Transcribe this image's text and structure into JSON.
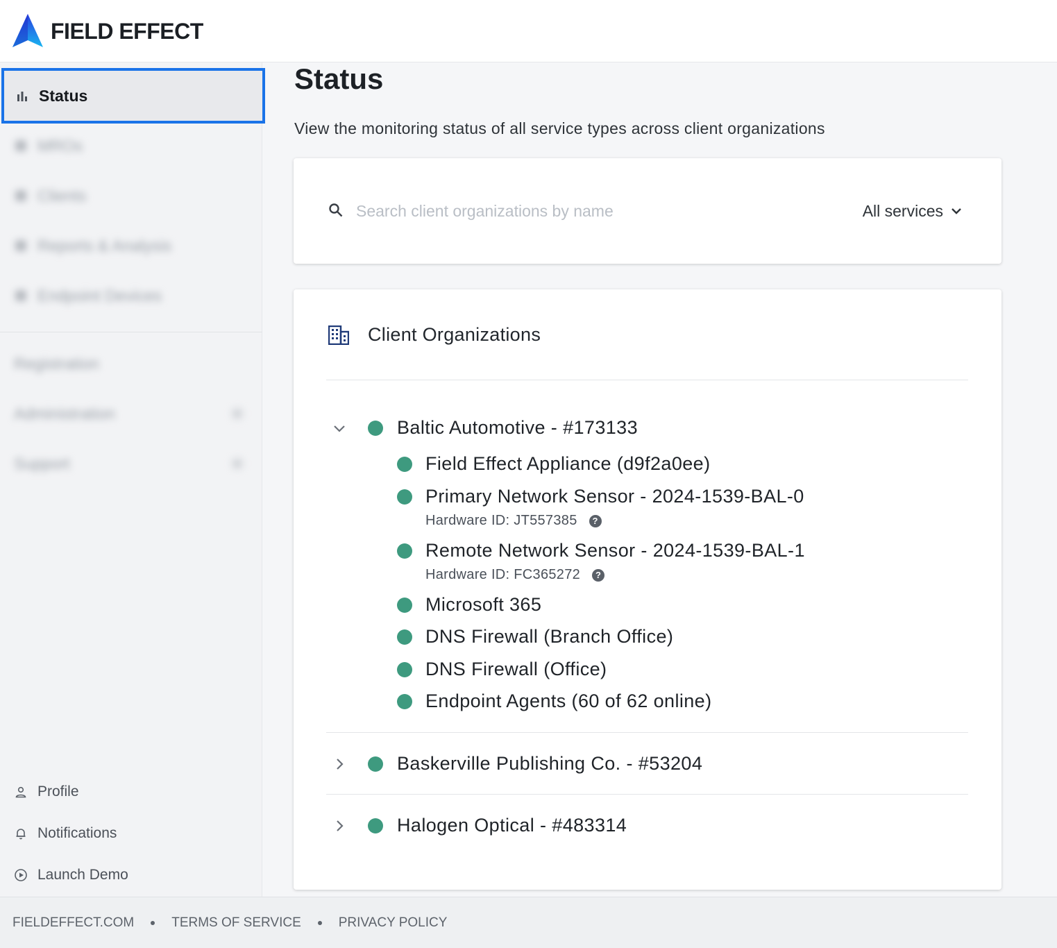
{
  "brand": {
    "name": "FIELD EFFECT"
  },
  "sidebar": {
    "items": [
      {
        "label": "Status",
        "icon": "bar-chart-icon",
        "active": true
      },
      {
        "label": "MROs",
        "icon": "building-icon",
        "blurred": true
      },
      {
        "label": "Clients",
        "icon": "users-icon",
        "blurred": true
      },
      {
        "label": "Reports & Analysis",
        "icon": "report-icon",
        "blurred": true
      },
      {
        "label": "Endpoint Devices",
        "icon": "laptop-icon",
        "blurred": true
      }
    ],
    "secondary": [
      {
        "label": "Registration",
        "blurred": true
      },
      {
        "label": "Administration",
        "blurred": true
      },
      {
        "label": "Support",
        "blurred": true
      }
    ],
    "bottom": [
      {
        "label": "Profile",
        "icon": "person-icon"
      },
      {
        "label": "Notifications",
        "icon": "bell-icon"
      },
      {
        "label": "Launch Demo",
        "icon": "play-circle-icon"
      }
    ]
  },
  "main": {
    "title": "Status",
    "subtitle": "View the monitoring status of all service types across client organizations",
    "search": {
      "placeholder": "Search client organizations by name",
      "value": ""
    },
    "service_filter": "All services",
    "orgs_heading": "Client Organizations",
    "orgs": [
      {
        "name": "Baltic Automotive - #173133",
        "expanded": true,
        "status": "ok",
        "services": [
          {
            "name": "Field Effect Appliance (d9f2a0ee)",
            "status": "ok"
          },
          {
            "name": "Primary Network Sensor - 2024-1539-BAL-0",
            "status": "ok",
            "hardware_id": "Hardware ID: JT557385"
          },
          {
            "name": "Remote Network Sensor - 2024-1539-BAL-1",
            "status": "ok",
            "hardware_id": "Hardware ID: FC365272"
          },
          {
            "name": "Microsoft 365",
            "status": "ok"
          },
          {
            "name": "DNS Firewall (Branch Office)",
            "status": "ok"
          },
          {
            "name": "DNS Firewall (Office)",
            "status": "ok"
          },
          {
            "name": "Endpoint Agents (60 of 62 online)",
            "status": "ok"
          }
        ]
      },
      {
        "name": "Baskerville Publishing Co. - #53204",
        "expanded": false,
        "status": "ok"
      },
      {
        "name": "Halogen Optical - #483314",
        "expanded": false,
        "status": "ok"
      }
    ]
  },
  "footer": {
    "links": [
      "FIELDEFFECT.COM",
      "TERMS OF SERVICE",
      "PRIVACY POLICY"
    ]
  },
  "colors": {
    "accent": "#1a73e8",
    "status_ok": "#3e9a7f"
  }
}
